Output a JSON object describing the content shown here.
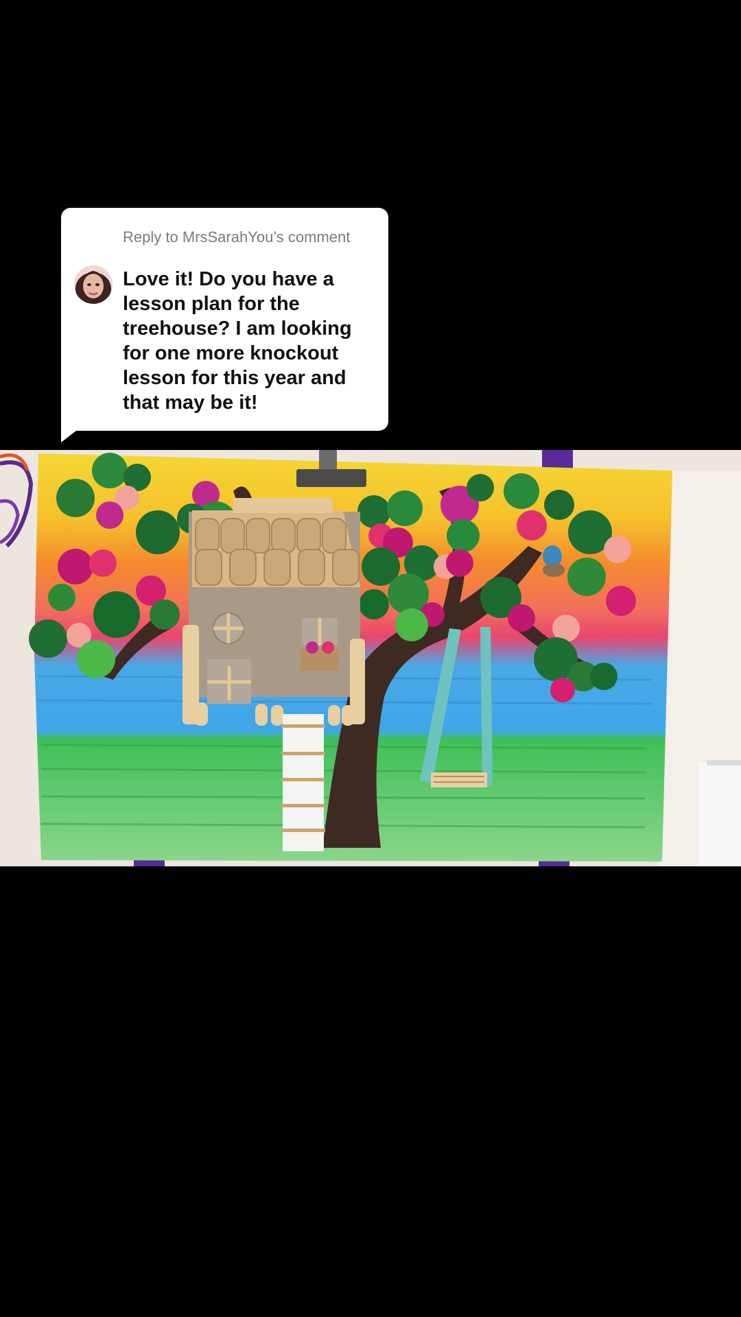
{
  "reply": {
    "header_prefix": "Reply to ",
    "header_user": "MrsSarahYou",
    "header_suffix": "’s comment",
    "comment": "Love it! Do you have a lesson plan for the treehouse? I am looking for one more knockout lesson for this year and that may be it!"
  },
  "photo": {
    "subject_icon": "treehouse-collage-artwork"
  }
}
